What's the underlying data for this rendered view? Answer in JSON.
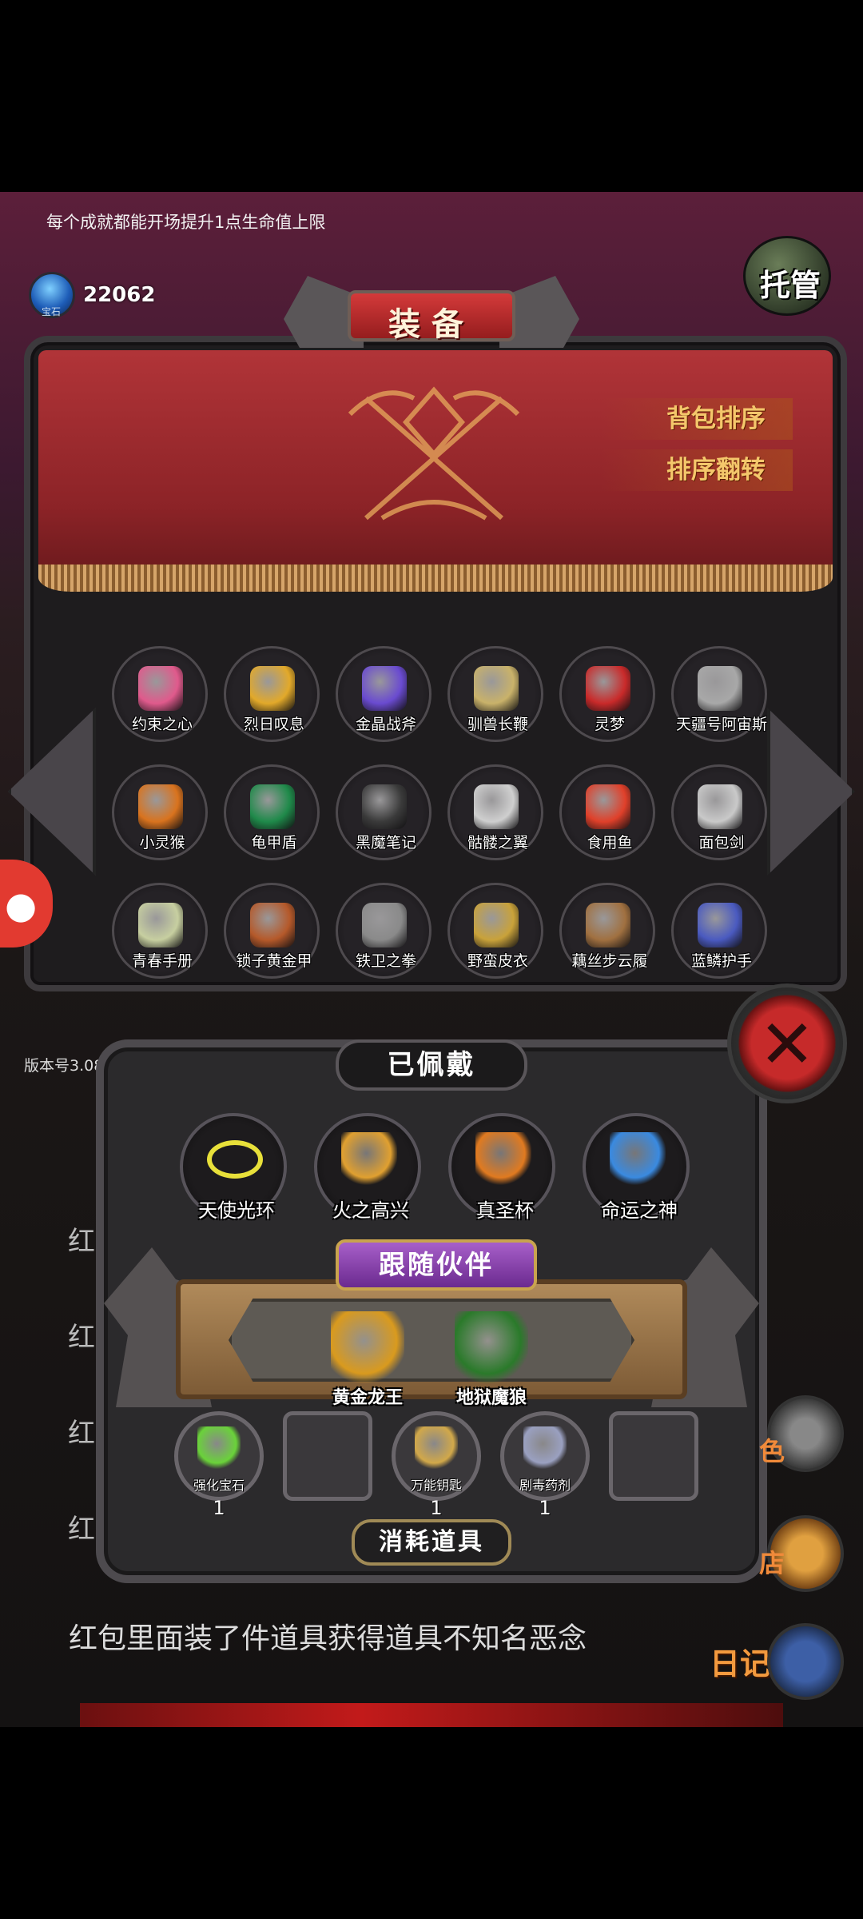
{
  "tip": "每个成就都能开场提升1点生命值上限",
  "gems": {
    "icon": "blue-gem-icon",
    "label": "宝石",
    "value": "22062"
  },
  "auto_button": "托管",
  "panel_title": "装备",
  "sort_buttons": {
    "sort": "背包排序",
    "reverse": "排序翻转"
  },
  "inventory": [
    {
      "label": "约束之心",
      "icon": "pink-heart-orb-icon",
      "color": "#e05a8c"
    },
    {
      "label": "烈日叹息",
      "icon": "golden-staff-icon",
      "color": "#e2a92a"
    },
    {
      "label": "金晶战斧",
      "icon": "purple-axe-icon",
      "color": "#6a4bd0"
    },
    {
      "label": "驯兽长鞭",
      "icon": "coiled-whip-icon",
      "color": "#c9b26a"
    },
    {
      "label": "灵梦",
      "icon": "shrine-maiden-icon",
      "color": "#c92a2a"
    },
    {
      "label": "天疆号阿宙斯",
      "icon": "mech-robot-icon",
      "color": "#a8a8a8"
    },
    {
      "label": "小灵猴",
      "icon": "orange-monkey-icon",
      "color": "#d9731e"
    },
    {
      "label": "龟甲盾",
      "icon": "turtle-shell-shield-icon",
      "color": "#1f8a4a"
    },
    {
      "label": "黑魔笔记",
      "icon": "black-notebook-icon",
      "color": "#3a3a3a"
    },
    {
      "label": "骷髅之翼",
      "icon": "bone-wings-icon",
      "color": "#cfcfcf"
    },
    {
      "label": "食用鱼",
      "icon": "goldfish-icon",
      "color": "#e0402a"
    },
    {
      "label": "面包剑",
      "icon": "bread-sword-icon",
      "color": "#c9c9c9"
    },
    {
      "label": "青春手册",
      "icon": "green-book-icon",
      "color": "#c7cfa0"
    },
    {
      "label": "锁子黄金甲",
      "icon": "golden-armor-icon",
      "color": "#b5592a"
    },
    {
      "label": "铁卫之拳",
      "icon": "iron-gauntlet-icon",
      "color": "#8a8a8a"
    },
    {
      "label": "野蛮皮衣",
      "icon": "leopard-vest-icon",
      "color": "#c9a23a"
    },
    {
      "label": "藕丝步云履",
      "icon": "cloud-boots-icon",
      "color": "#a07040"
    },
    {
      "label": "蓝鳞护手",
      "icon": "blue-gauntlet-icon",
      "color": "#4a5ac0"
    }
  ],
  "version": "版本号3.08",
  "equipped_title": "已佩戴",
  "equipped": [
    {
      "label": "天使光环",
      "icon": "halo-ring-icon",
      "color": "#e8e03a"
    },
    {
      "label": "火之高兴",
      "icon": "flame-sword-icon",
      "color": "#e0a030"
    },
    {
      "label": "真圣杯",
      "icon": "holy-grail-icon",
      "color": "#e07a20"
    },
    {
      "label": "命运之神",
      "icon": "blue-amulet-icon",
      "color": "#3a8ae0"
    }
  ],
  "pet_title": "跟随伙伴",
  "pets": [
    {
      "label": "黄金龙王",
      "icon": "golden-dragon-icon",
      "color": "#d99a1e"
    },
    {
      "label": "地狱魔狼",
      "icon": "hell-wolf-icon",
      "color": "#2a7a2a"
    }
  ],
  "consumables_title": "消耗道具",
  "consumables": [
    {
      "label": "强化宝石",
      "icon": "green-gem-icon",
      "color": "#6ad23a",
      "count": "1"
    },
    {
      "label": "",
      "icon": "empty-slot",
      "color": "",
      "count": ""
    },
    {
      "label": "万能钥匙",
      "icon": "golden-key-icon",
      "color": "#d1a84a",
      "count": "1"
    },
    {
      "label": "剧毒药剂",
      "icon": "poison-bottle-icon",
      "color": "#9aa0c0",
      "count": "1"
    },
    {
      "label": "",
      "icon": "empty-slot",
      "color": "",
      "count": ""
    }
  ],
  "log_lines": [
    "红",
    "红",
    "红",
    "红"
  ],
  "log_message": "红包里面装了件道具获得道具不知名恶念",
  "side_labels": {
    "helmet": "色",
    "drink": "店"
  },
  "diary_label": "日记"
}
